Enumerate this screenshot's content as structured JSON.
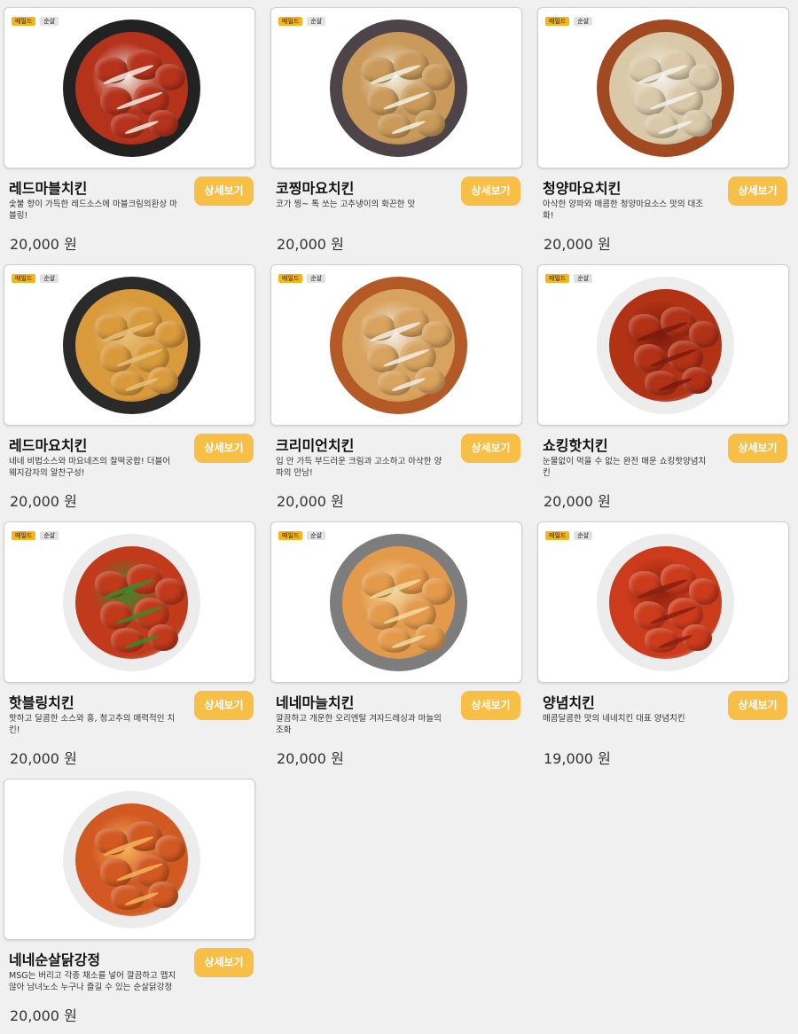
{
  "items": [
    {
      "badges": [
        "매일드",
        "순살"
      ],
      "name": "레드마블치킨",
      "desc": "숯불 향이 가득한 레드소스에 마블크림의환상 마블링!",
      "price": "20,000 원",
      "button": "상세보기",
      "plate": "#222222",
      "food": "#b5321b",
      "accent": "#f1ece4",
      "image": "red-marble-chicken-photo"
    },
    {
      "badges": [
        "매일드",
        "순살"
      ],
      "name": "코찡마요치킨",
      "desc": "코가 찡~ 톡 쏘는 고추냉이의 화끈한 맛",
      "price": "20,000 원",
      "button": "상세보기",
      "plate": "#4c4448",
      "food": "#c99a5a",
      "accent": "#f3f1e2",
      "image": "kozzing-mayo-chicken-photo"
    },
    {
      "badges": [
        "매일드",
        "순살"
      ],
      "name": "청양마요치킨",
      "desc": "아삭한 양파와 매콤한 청양마요소스 맛의 대조화!",
      "price": "20,000 원",
      "button": "상세보기",
      "plate": "#a14a21",
      "food": "#d9c9a8",
      "accent": "#f4f1ea",
      "image": "cheongyang-mayo-chicken-photo"
    },
    {
      "badges": [
        "매일드",
        "순살"
      ],
      "name": "레드마요치킨",
      "desc": "네네 비법소스와 마요네즈의 찰떡궁합! 더블어 웨지감자의 알찬구성!",
      "price": "20,000 원",
      "button": "상세보기",
      "plate": "#2a2a2a",
      "food": "#d99a3c",
      "accent": "#e9c07a",
      "image": "red-mayo-chicken-photo"
    },
    {
      "badges": [
        "매일드",
        "순살"
      ],
      "name": "크리미언치킨",
      "desc": "입 안 가득 부드러운 크림과 고소하고 아삭한 양파의 만남!",
      "price": "20,000 원",
      "button": "상세보기",
      "plate": "#b45a26",
      "food": "#d8a35e",
      "accent": "#f2efe8",
      "image": "creamy-onion-chicken-photo"
    },
    {
      "badges": [
        "매일드",
        "순살"
      ],
      "name": "쇼킹핫치킨",
      "desc": "눈물없이 먹을 수 없는 완전 매운 쇼킹핫양념치킨",
      "price": "20,000 원",
      "button": "상세보기",
      "plate": "#ededed",
      "food": "#b23216",
      "accent": "#7a1a0e",
      "image": "shocking-hot-chicken-photo"
    },
    {
      "badges": [
        "매일드",
        "순살"
      ],
      "name": "핫블링치킨",
      "desc": "핫하고 달콤한 소스와 홍, 청고추의 매력적인 치킨!",
      "price": "20,000 원",
      "button": "상세보기",
      "plate": "#ececec",
      "food": "#c13a1c",
      "accent": "#3b8a2a",
      "image": "hot-bling-chicken-photo"
    },
    {
      "badges": [
        "매일드",
        "순살"
      ],
      "name": "네네마늘치킨",
      "desc": "깔끔하고 개운한 오리엔탈 겨자드레싱과 마늘의 조화",
      "price": "20,000 원",
      "button": "상세보기",
      "plate": "#7d7d7d",
      "food": "#e39a4a",
      "accent": "#f3d9a0",
      "image": "nene-garlic-chicken-photo"
    },
    {
      "badges": [
        "매일드",
        "순살"
      ],
      "name": "양념치킨",
      "desc": "매콤달콤한 맛의 네네치킨 대표 양념치킨",
      "price": "19,000 원",
      "button": "상세보기",
      "plate": "#ececec",
      "food": "#cc3b1c",
      "accent": "#8a1f0e",
      "image": "yangnyeom-chicken-photo"
    },
    {
      "badges": [],
      "name": "네네순살닭강정",
      "desc": "MSG는 버리고 각종 채소를 넣어 깔끔하고 맵지 않아 남녀노소 누구나 즐길 수 있는 순살닭강정",
      "price": "20,000 원",
      "button": "상세보기",
      "plate": "#ececec",
      "food": "#d25a22",
      "accent": "#f5b35a",
      "image": "nene-boneless-dakgangjeong-photo"
    }
  ]
}
